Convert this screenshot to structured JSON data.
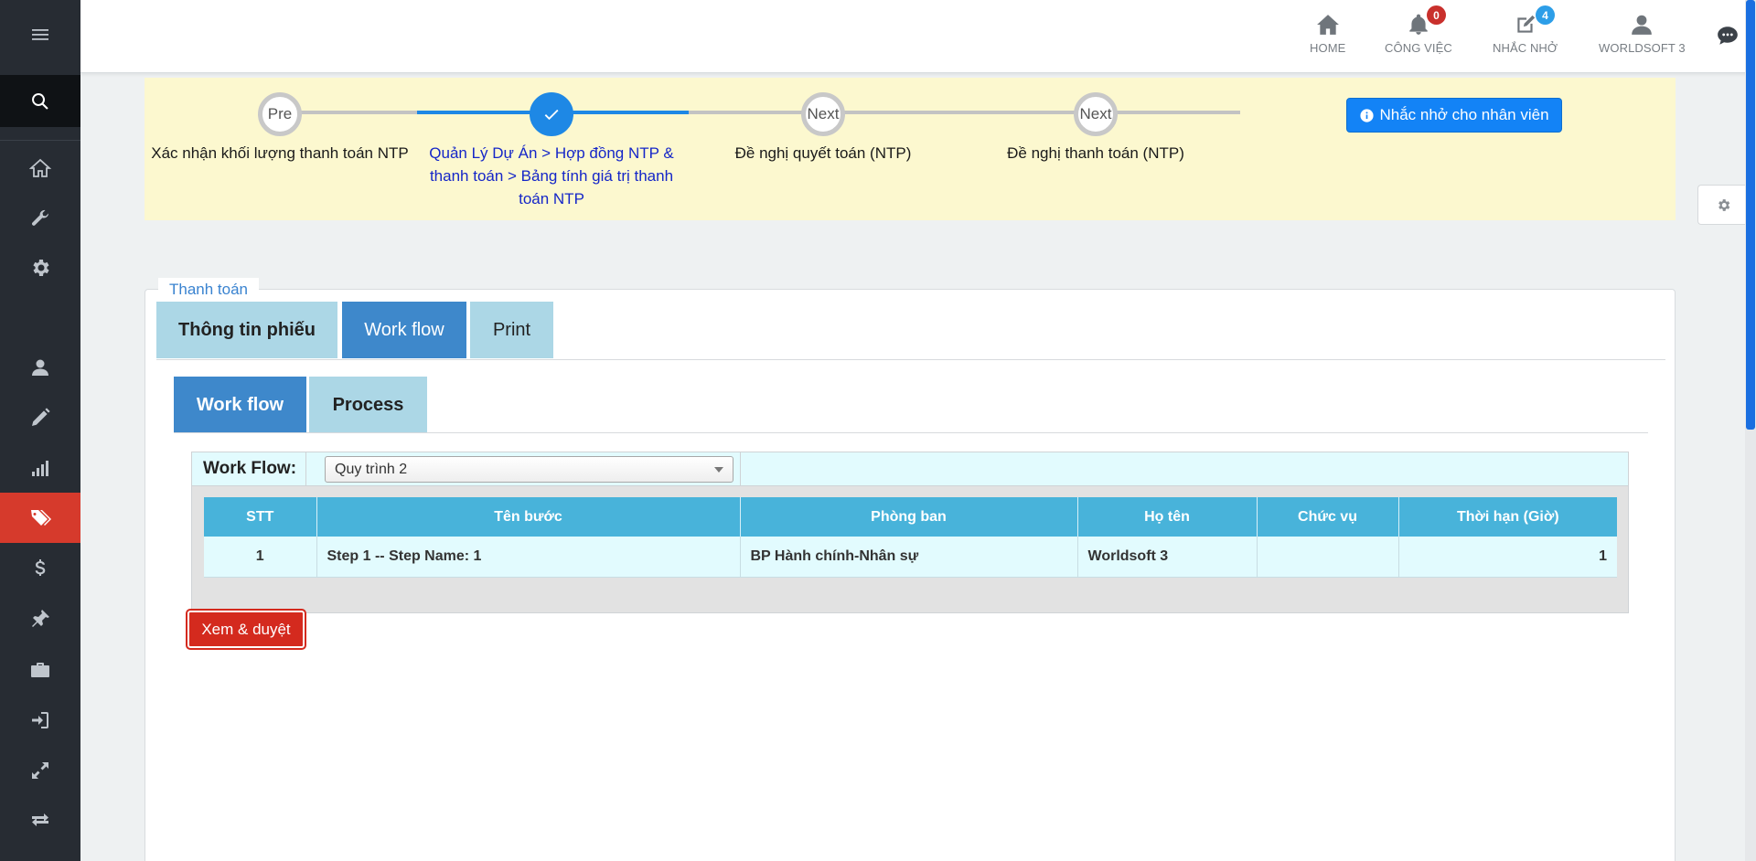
{
  "topbar": {
    "home_label": "HOME",
    "tasks_label": "CÔNG VIỆC",
    "tasks_badge": "0",
    "reminders_label": "NHẮC NHỞ",
    "reminders_badge": "4",
    "user_label": "WORLDSOFT 3"
  },
  "sidebar": {
    "items": [
      "menu-icon",
      "search-icon",
      "home-icon",
      "wrench-icon",
      "gear-icon",
      "user-icon",
      "pencil-icon",
      "bar-chart-icon",
      "tags-icon",
      "dollar-icon",
      "pin-icon",
      "briefcase-icon",
      "sign-in-icon",
      "expand-icon",
      "exchange-icon"
    ],
    "active_item": "tags-icon",
    "active_color": "#d63a2c"
  },
  "steps": {
    "items": [
      {
        "circle": "Pre",
        "label": "Xác nhận khối lượng thanh toán NTP",
        "status": "previous"
      },
      {
        "circle": "",
        "label": "Quản Lý Dự Án > Hợp đồng NTP & thanh toán > Bảng tính giá trị thanh toán NTP",
        "status": "current"
      },
      {
        "circle": "Next",
        "label": "Đề nghị quyết toán (NTP)",
        "status": "next"
      },
      {
        "circle": "Next",
        "label": "Đề nghị thanh toán (NTP)",
        "status": "next"
      }
    ],
    "remind_button": "Nhắc nhở cho nhân viên",
    "accent_color": "#1e88e5",
    "panel_color": "#fcf8cf"
  },
  "card": {
    "title": "Thanh toán",
    "tabs": [
      "Thông tin phiếu",
      "Work flow",
      "Print"
    ],
    "active_tab": "Work flow",
    "subtabs": [
      "Work flow",
      "Process"
    ],
    "active_subtab": "Work flow"
  },
  "workflow": {
    "label": "Work Flow:",
    "selected": "Quy trình 2",
    "table": {
      "headers": [
        "STT",
        "Tên bước",
        "Phòng ban",
        "Họ tên",
        "Chức vụ",
        "Thời hạn (Giờ)"
      ],
      "rows": [
        [
          "1",
          "Step 1 -- Step Name: 1",
          "BP Hành chính-Nhân sự",
          "Worldsoft 3",
          "",
          "1"
        ]
      ]
    },
    "approve_button": "Xem & duyệt",
    "header_color": "#48b3da",
    "row_color": "#e2fbfe",
    "button_color": "#d42a1e"
  }
}
